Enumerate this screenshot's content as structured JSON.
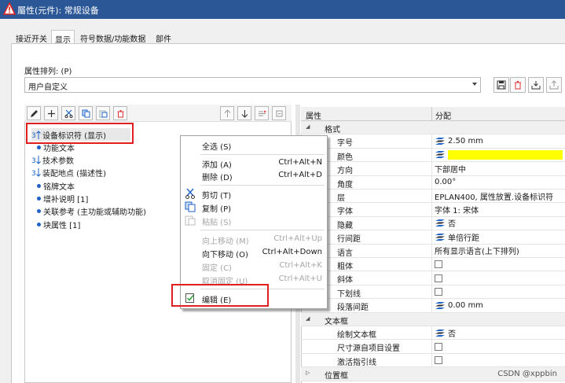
{
  "window": {
    "title": "屬性(元件): 常规设备"
  },
  "tabs": [
    "接近开关",
    "显示",
    "符号数据/功能数据",
    "部件"
  ],
  "property_arrangement": {
    "label": "属性排列: (P)",
    "value": "用户自定义"
  },
  "tree": {
    "items": [
      {
        "label": "设备标识符 (显示)",
        "type": "arrow"
      },
      {
        "label": "功能文本",
        "type": "dot"
      },
      {
        "label": "技术参数",
        "type": "arrow"
      },
      {
        "label": "装配地点 (描述性)",
        "type": "arrow"
      },
      {
        "label": "铭牌文本",
        "type": "dot"
      },
      {
        "label": "增补说明 [1]",
        "type": "dot"
      },
      {
        "label": "关联参考 (主功能或辅助功能)",
        "type": "dot"
      },
      {
        "label": "块属性 [1]",
        "type": "dot"
      }
    ]
  },
  "context_menu": {
    "items": [
      {
        "label": "全选 (S)",
        "shortcut": "",
        "enabled": true
      },
      {
        "label": "添加 (A)",
        "shortcut": "Ctrl+Alt+N",
        "enabled": true
      },
      {
        "label": "删除 (D)",
        "shortcut": "Ctrl+Alt+D",
        "enabled": true
      },
      {
        "label": "剪切 (T)",
        "shortcut": "",
        "enabled": true
      },
      {
        "label": "复制 (P)",
        "shortcut": "",
        "enabled": true
      },
      {
        "label": "粘贴 (S)",
        "shortcut": "",
        "enabled": false
      },
      {
        "label": "向上移动 (M)",
        "shortcut": "Ctrl+Alt+Up",
        "enabled": false
      },
      {
        "label": "向下移动 (O)",
        "shortcut": "Ctrl+Alt+Down",
        "enabled": true
      },
      {
        "label": "固定 (C)",
        "shortcut": "Ctrl+Alt+K",
        "enabled": false
      },
      {
        "label": "取消固定 (U)",
        "shortcut": "Ctrl+Alt+U",
        "enabled": false
      },
      {
        "label": "编辑 (E)",
        "shortcut": "",
        "enabled": true
      }
    ]
  },
  "property_grid": {
    "headers": {
      "property": "属性",
      "value": "分配"
    },
    "rows": [
      {
        "kind": "category",
        "label": "格式"
      },
      {
        "kind": "prop",
        "label": "字号",
        "value": "2.50 mm",
        "icon": "layer-icon"
      },
      {
        "kind": "prop",
        "label": "颜色",
        "value": "",
        "icon": "layer-icon",
        "swatch": "#ffff00"
      },
      {
        "kind": "prop",
        "label": "方向",
        "value": "下部居中"
      },
      {
        "kind": "prop",
        "label": "角度",
        "value": "0.00°"
      },
      {
        "kind": "prop",
        "label": "层",
        "value": "EPLAN400, 属性放置.设备标识符"
      },
      {
        "kind": "prop",
        "label": "字体",
        "value": "字体 1: 宋体"
      },
      {
        "kind": "prop",
        "label": "隐藏",
        "value": "否",
        "icon": "layer-icon"
      },
      {
        "kind": "prop",
        "label": "行间距",
        "value": "单倍行距",
        "icon": "layer-icon"
      },
      {
        "kind": "prop",
        "label": "语言",
        "value": "所有显示语言(上下排列)"
      },
      {
        "kind": "prop",
        "label": "粗体",
        "value": "",
        "checkbox": true
      },
      {
        "kind": "prop",
        "label": "斜体",
        "value": "",
        "checkbox": true
      },
      {
        "kind": "prop",
        "label": "下划线",
        "value": "",
        "checkbox": true
      },
      {
        "kind": "prop",
        "label": "段落间距",
        "value": "0.00 mm",
        "icon": "layer-icon"
      },
      {
        "kind": "category",
        "label": "文本框"
      },
      {
        "kind": "prop",
        "label": "绘制文本框",
        "value": "否",
        "icon": "layer-icon"
      },
      {
        "kind": "prop",
        "label": "尺寸源自项目设置",
        "value": "",
        "checkbox": true
      },
      {
        "kind": "prop",
        "label": "激活指引线",
        "value": "",
        "checkbox": true
      },
      {
        "kind": "category",
        "label": "位置框"
      }
    ]
  },
  "watermark": "CSDN @xppbin",
  "colors": {
    "titlebar": "#2b5797",
    "highlight_box": "#e02020",
    "tree_dot": "#1e62c8",
    "color_swatch": "#ffff00"
  }
}
